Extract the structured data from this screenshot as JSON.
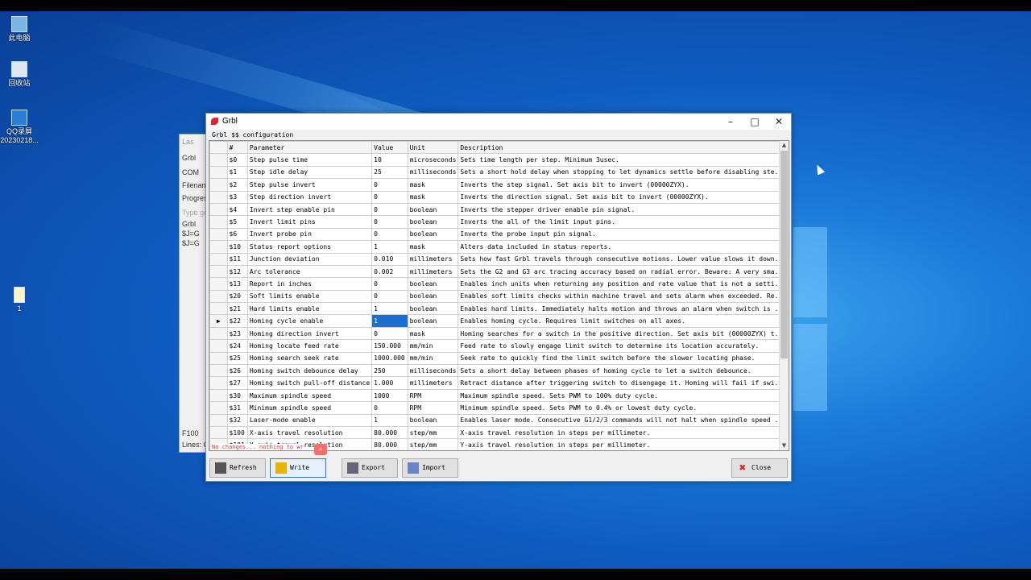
{
  "desktop": {
    "icons": [
      {
        "label": "此电脑"
      },
      {
        "label": "回收站"
      },
      {
        "label": "QQ录屏\n20230218..."
      },
      {
        "label": "1"
      }
    ]
  },
  "background_window": {
    "title": "Las",
    "menu": "Grbl",
    "tab": "COM",
    "filename_label": "Filename",
    "progress_label": "Progress",
    "type_hint": "Type gcod",
    "log_items": [
      "Grbl",
      "$J=G",
      "$J=G"
    ],
    "feed_label": "F100",
    "lines_label": "Lines: C"
  },
  "window": {
    "title": "Grbl",
    "subheading": "Grbl $$ configuration",
    "status_text": "No changes... nothing to wr",
    "buttons": {
      "refresh": "Refresh",
      "write": "Write",
      "export": "Export",
      "import": "Import",
      "close": "Close"
    }
  },
  "table": {
    "columns": [
      "#",
      "Parameter",
      "Value",
      "Unit",
      "Description"
    ],
    "active_row": 13,
    "rows": [
      [
        "$0",
        "Step pulse time",
        "10",
        "microseconds",
        "Sets time length per step. Minimum 3usec."
      ],
      [
        "$1",
        "Step idle delay",
        "25",
        "milliseconds",
        "Sets a short hold delay when stopping to let dynamics settle before disabling ste..."
      ],
      [
        "$2",
        "Step pulse invert",
        "0",
        "mask",
        "Inverts the step signal. Set axis bit to invert (00000ZYX)."
      ],
      [
        "$3",
        "Step direction invert",
        "0",
        "mask",
        "Inverts the direction signal. Set axis bit to invert (00000ZYX)."
      ],
      [
        "$4",
        "Invert step enable pin",
        "0",
        "boolean",
        "Inverts the stepper driver enable pin signal."
      ],
      [
        "$5",
        "Invert limit pins",
        "0",
        "boolean",
        "Inverts the all of the limit input pins."
      ],
      [
        "$6",
        "Invert probe pin",
        "0",
        "boolean",
        "Inverts the probe input pin signal."
      ],
      [
        "$10",
        "Status report options",
        "1",
        "mask",
        "Alters data included in status reports."
      ],
      [
        "$11",
        "Junction deviation",
        "0.010",
        "millimeters",
        "Sets how fast Grbl travels through consecutive motions. Lower value slows it down."
      ],
      [
        "$12",
        "Arc tolerance",
        "0.002",
        "millimeters",
        "Sets the G2 and G3 arc tracing accuracy based on radial error. Beware: A very sma..."
      ],
      [
        "$13",
        "Report in inches",
        "0",
        "boolean",
        "Enables inch units when returning any position and rate value that is not a setti..."
      ],
      [
        "$20",
        "Soft limits enable",
        "0",
        "boolean",
        "Enables soft limits checks within machine travel and sets alarm when exceeded. Re..."
      ],
      [
        "$21",
        "Hard limits enable",
        "1",
        "boolean",
        "Enables hard limits. Immediately halts motion and throws an alarm when switch is ..."
      ],
      [
        "$22",
        "Homing cycle enable",
        "1",
        "boolean",
        "Enables homing cycle. Requires limit switches on all axes."
      ],
      [
        "$23",
        "Homing direction invert",
        "0",
        "mask",
        "Homing searches for a switch in the positive direction. Set axis bit (00000ZYX) t..."
      ],
      [
        "$24",
        "Homing locate feed rate",
        "150.000",
        "mm/min",
        "Feed rate to slowly engage limit switch to determine its location accurately."
      ],
      [
        "$25",
        "Homing search seek rate",
        "1000.000",
        "mm/min",
        "Seek rate to quickly find the limit switch before the slower locating phase."
      ],
      [
        "$26",
        "Homing switch debounce delay",
        "250",
        "milliseconds",
        "Sets a short delay between phases of homing cycle to let a switch debounce."
      ],
      [
        "$27",
        "Homing switch pull-off distance",
        "1.000",
        "millimeters",
        "Retract distance after triggering switch to disengage it. Homing will fail if swi..."
      ],
      [
        "$30",
        "Maximum spindle speed",
        "1000",
        "RPM",
        "Maximum spindle speed. Sets PWM to 100% duty cycle."
      ],
      [
        "$31",
        "Minimum spindle speed",
        "0",
        "RPM",
        "Minimum spindle speed. Sets PWM to 0.4% or lowest duty cycle."
      ],
      [
        "$32",
        "Laser-mode enable",
        "1",
        "boolean",
        "Enables laser mode. Consecutive G1/2/3 commands will not halt when spindle speed ..."
      ],
      [
        "$100",
        "X-axis travel resolution",
        "80.000",
        "step/mm",
        "X-axis travel resolution in steps per millimeter."
      ],
      [
        "$101",
        "Y-axis travel resolution",
        "80.000",
        "step/mm",
        "Y-axis travel resolution in steps per millimeter."
      ]
    ]
  }
}
